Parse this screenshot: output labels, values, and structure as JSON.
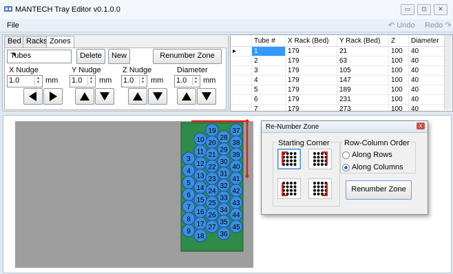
{
  "window": {
    "title": "MANTECH Tray Editor v0.1.0.0",
    "min": "▭",
    "max": "⊡",
    "close": "✕"
  },
  "menu": {
    "file": "File",
    "undo": "↶ Undo",
    "redo": "Redo ↷"
  },
  "tabs": [
    "Bed",
    "Racks",
    "Zones"
  ],
  "zones": {
    "combo_value": "Tubes",
    "delete": "Delete",
    "new": "New",
    "renumber": "Renumber Zone",
    "x_label": "X Nudge",
    "y_label": "Y Nudge",
    "z_label": "Z Nudge",
    "d_label": "Diameter",
    "x_val": "1.0",
    "y_val": "1.0",
    "z_val": "1.0",
    "d_val": "1.0",
    "unit": "mm"
  },
  "grid": {
    "headers": [
      "Tube #",
      "X Rack (Bed)",
      "Y Rack (Bed)",
      "Z",
      "Diameter"
    ],
    "rows": [
      [
        "1",
        "179",
        "21",
        "100",
        "40"
      ],
      [
        "2",
        "179",
        "63",
        "100",
        "40"
      ],
      [
        "3",
        "179",
        "105",
        "100",
        "40"
      ],
      [
        "4",
        "179",
        "147",
        "100",
        "40"
      ],
      [
        "5",
        "179",
        "189",
        "100",
        "40"
      ],
      [
        "6",
        "179",
        "231",
        "100",
        "40"
      ],
      [
        "7",
        "179",
        "273",
        "100",
        "40"
      ]
    ]
  },
  "tubes": [
    [
      "3",
      "4",
      "5",
      "6",
      "7",
      "8",
      "9"
    ],
    [
      "10",
      "11",
      "12",
      "13",
      "14",
      "15",
      "16",
      "17",
      "18"
    ],
    [
      "19",
      "20",
      "21",
      "22",
      "23",
      "24",
      "25",
      "26",
      "27"
    ],
    [
      "28",
      "29",
      "30",
      "31",
      "32",
      "33",
      "34",
      "35",
      "36"
    ],
    [
      "37",
      "38",
      "39",
      "40",
      "41",
      "42",
      "43",
      "44",
      "45"
    ]
  ],
  "colors": {
    "tray": "#2e8b48",
    "tube": "#3c8ee0",
    "tube_border": "#1a4fa8",
    "selection": "#e0201a"
  },
  "dialog": {
    "title": "Re-Number Zone",
    "close": "x",
    "corner_label": "Starting Corner",
    "order_label": "Row-Column Order",
    "along_rows": "Along Rows",
    "along_columns": "Along Columns",
    "renumber": "Renumber Zone"
  }
}
